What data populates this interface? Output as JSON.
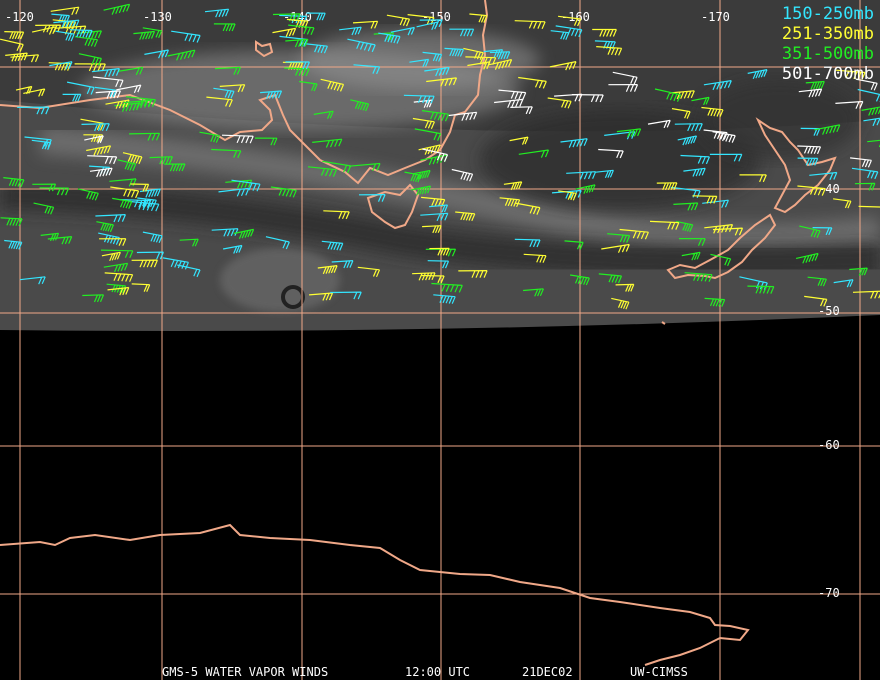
{
  "title": "",
  "legend": [
    {
      "label": "150-250mb",
      "color": "#33e6ff"
    },
    {
      "label": "251-350mb",
      "color": "#ffff33"
    },
    {
      "label": "351-500mb",
      "color": "#22ee22"
    },
    {
      "label": "501-700mb",
      "color": "#ffffff"
    }
  ],
  "longitude_labels": [
    "-120",
    "-130",
    "-140",
    "-150",
    "-160",
    "-170"
  ],
  "latitude_labels": [
    "-40",
    "-50",
    "-60",
    "-70"
  ],
  "footer": {
    "product": "GMS-5 WATER VAPOR WINDS",
    "time": "12:00 UTC",
    "date": "21DEC02",
    "source": "UW-CIMSS"
  },
  "colors": {
    "grid": "#f0a888",
    "coast": "#f0a888",
    "background": "#000000"
  }
}
